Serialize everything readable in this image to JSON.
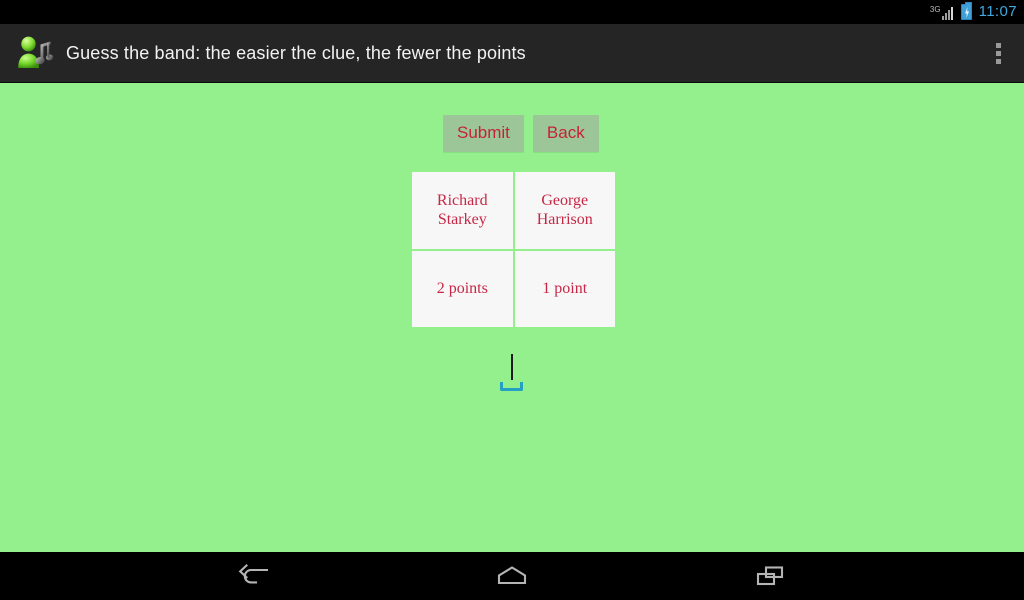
{
  "statusbar": {
    "network_label": "3G",
    "network_icon": "signal-bars-icon",
    "battery_icon": "battery-charging-icon",
    "time": "11:07",
    "time_color": "#3fa9e0"
  },
  "actionbar": {
    "app_icon": "band-music-note-icon",
    "title": "Guess the band: the easier the clue, the fewer the points",
    "overflow_icon": "overflow-menu-icon",
    "background": "#252525"
  },
  "content": {
    "background": "#93F08D",
    "buttons": [
      {
        "label": "Submit",
        "name": "submit-button"
      },
      {
        "label": "Back",
        "name": "back-button"
      }
    ],
    "button_bg": "#9CC698",
    "button_text_color": "#C62235",
    "table": {
      "cell_bg": "#F7F7F7",
      "cell_text_color": "#C62746",
      "rows": [
        [
          "Richard Starkey",
          "George Harrison"
        ],
        [
          "2 points",
          "1 point"
        ]
      ]
    },
    "text_input": {
      "value": "",
      "placeholder": "",
      "caret_visible": true,
      "handle_color": "#23A0C4"
    }
  },
  "navbar": {
    "background": "#000000",
    "buttons": [
      {
        "label": "Back",
        "name": "nav-back-icon"
      },
      {
        "label": "Home",
        "name": "nav-home-icon"
      },
      {
        "label": "Recents",
        "name": "nav-recents-icon"
      }
    ]
  }
}
